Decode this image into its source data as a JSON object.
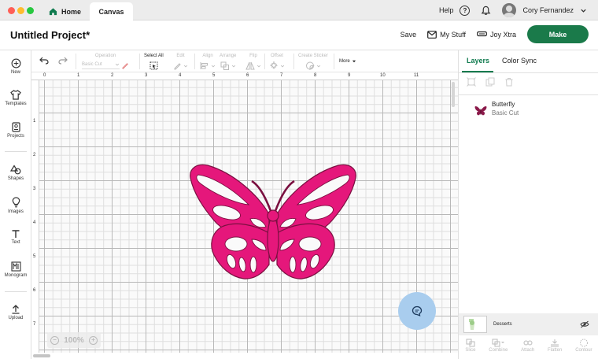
{
  "window": {
    "tabs": [
      {
        "label": "Home",
        "icon": "home-icon",
        "active": false
      },
      {
        "label": "Canvas",
        "active": true
      }
    ],
    "help_label": "Help",
    "user_name": "Cory Fernandez"
  },
  "header": {
    "project_title": "Untitled Project*",
    "save_label": "Save",
    "mystuff_label": "My Stuff",
    "joyxtra_label": "Joy Xtra",
    "make_label": "Make",
    "make_color": "#1a7a4a"
  },
  "rail": {
    "items": [
      {
        "label": "New",
        "icon": "plus-circle-icon"
      },
      {
        "label": "Templates",
        "icon": "shirt-icon"
      },
      {
        "label": "Projects",
        "icon": "projects-icon"
      },
      {
        "label": "Shapes",
        "icon": "shapes-icon"
      },
      {
        "label": "Images",
        "icon": "lightbulb-icon"
      },
      {
        "label": "Text",
        "icon": "text-icon"
      },
      {
        "label": "Monogram",
        "icon": "monogram-icon"
      },
      {
        "label": "Upload",
        "icon": "upload-icon"
      }
    ]
  },
  "toolbar": {
    "operation_label": "Operation",
    "operation_value": "Basic Cut",
    "select_all_label": "Select All",
    "edit_label": "Edit",
    "align_label": "Align",
    "arrange_label": "Arrange",
    "flip_label": "Flip",
    "offset_label": "Offset",
    "create_sticker_label": "Create Sticker",
    "more_label": "More"
  },
  "canvas": {
    "ruler_top": [
      "0",
      "1",
      "2",
      "3",
      "4",
      "5",
      "6",
      "7",
      "8",
      "9",
      "10",
      "11"
    ],
    "ruler_left": [
      "1",
      "2",
      "3",
      "4",
      "5",
      "6",
      "7"
    ],
    "zoom_level": "100%",
    "zoom_out": "−",
    "zoom_in": "+",
    "object_color": "#e5177b"
  },
  "panel": {
    "tab_layers": "Layers",
    "tab_color_sync": "Color Sync",
    "layer": {
      "name": "Butterfly",
      "operation": "Basic Cut",
      "icon": "butterfly-icon"
    },
    "mat_label": "Desserts",
    "bottom_tools": [
      {
        "label": "Slice",
        "icon": "slice-icon"
      },
      {
        "label": "Combine",
        "icon": "combine-icon"
      },
      {
        "label": "Attach",
        "icon": "attach-icon"
      },
      {
        "label": "Flatten",
        "icon": "flatten-icon"
      },
      {
        "label": "Contour",
        "icon": "contour-icon"
      }
    ]
  }
}
